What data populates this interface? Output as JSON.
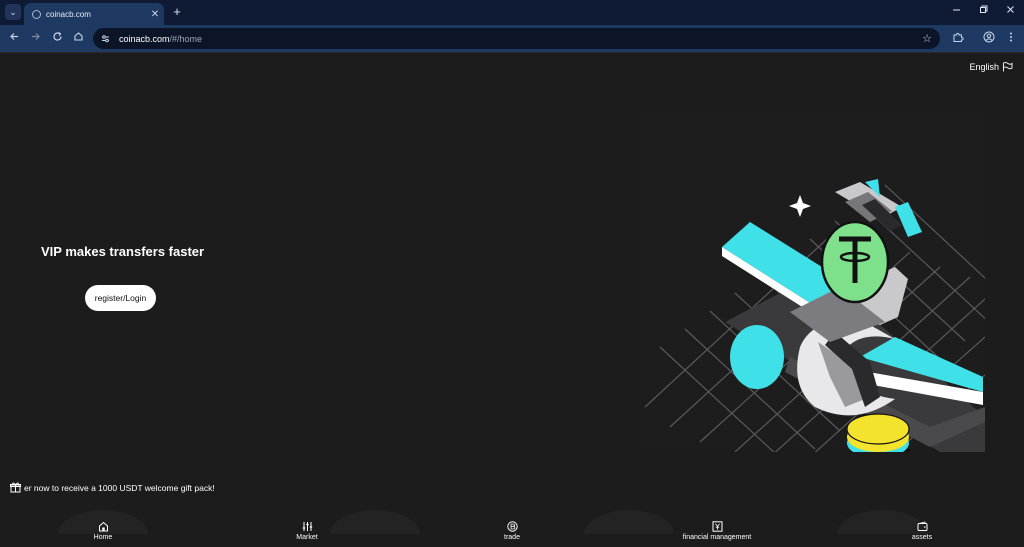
{
  "browser": {
    "tab_title": "coinacb.com",
    "url_host": "coinacb.com",
    "url_path": "/#/home",
    "new_tab_glyph": "+",
    "close_glyph": "✕"
  },
  "header": {
    "language": "English"
  },
  "hero": {
    "title": "VIP makes transfers faster",
    "login_label": "register/Login"
  },
  "promo": {
    "text": "er now to receive a 1000 USDT welcome gift pack!"
  },
  "bottom_nav": {
    "items": [
      {
        "label": "Home",
        "icon": "home-icon"
      },
      {
        "label": "Market",
        "icon": "market-sliders-icon"
      },
      {
        "label": "trade",
        "icon": "bitcoin-icon"
      },
      {
        "label": "financial management",
        "icon": "yen-icon"
      },
      {
        "label": "assets",
        "icon": "wallet-icon"
      }
    ]
  },
  "colors": {
    "background": "#1c1c1d",
    "accent_cyan": "#3fe0e8",
    "accent_green": "#7ee08a",
    "coin_yellow": "#f4e32c"
  }
}
